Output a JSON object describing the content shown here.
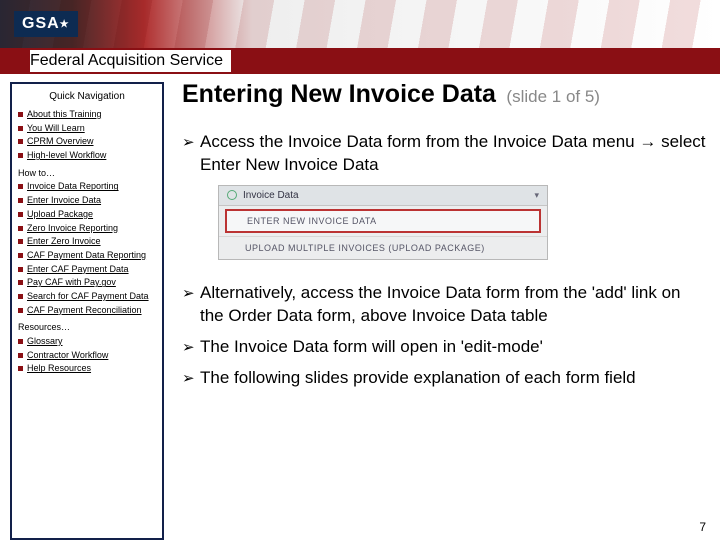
{
  "brand": {
    "logo": "GSA"
  },
  "fas_title": "Federal Acquisition Service",
  "sidebar": {
    "heading": "Quick Navigation",
    "group1": [
      "About this Training",
      "You Will Learn",
      "CPRM Overview",
      "High-level Workflow"
    ],
    "howto_label": "How to…",
    "group2": [
      "Invoice Data Reporting",
      "Enter Invoice Data",
      "Upload Package",
      "Zero Invoice Reporting",
      "Enter Zero Invoice",
      "CAF Payment Data Reporting",
      "Enter CAF Payment Data",
      "Pay CAF with Pay.gov",
      "Search for CAF Payment Data",
      "CAF Payment Reconciliation"
    ],
    "resources_label": "Resources…",
    "group3": [
      "Glossary",
      "Contractor Workflow",
      "Help Resources"
    ]
  },
  "title": "Entering New Invoice Data",
  "slide_indicator": "(slide 1 of 5)",
  "bullets": {
    "b1a": "Access the Invoice Data form from the Invoice Data menu ",
    "b1_arrow": "→",
    "b1b": " select Enter New Invoice Data",
    "b2": "Alternatively, access the Invoice Data form from the 'add' link on the Order Data form, above Invoice Data table",
    "b3": "The Invoice Data form will open in 'edit-mode'",
    "b4": "The following slides provide explanation of each form field"
  },
  "menu": {
    "tab": "Invoice Data",
    "tab_dd": "▾",
    "item_selected": "Enter New Invoice Data",
    "item_other": "Upload Multiple Invoices (Upload Package)"
  },
  "page_number": "7"
}
